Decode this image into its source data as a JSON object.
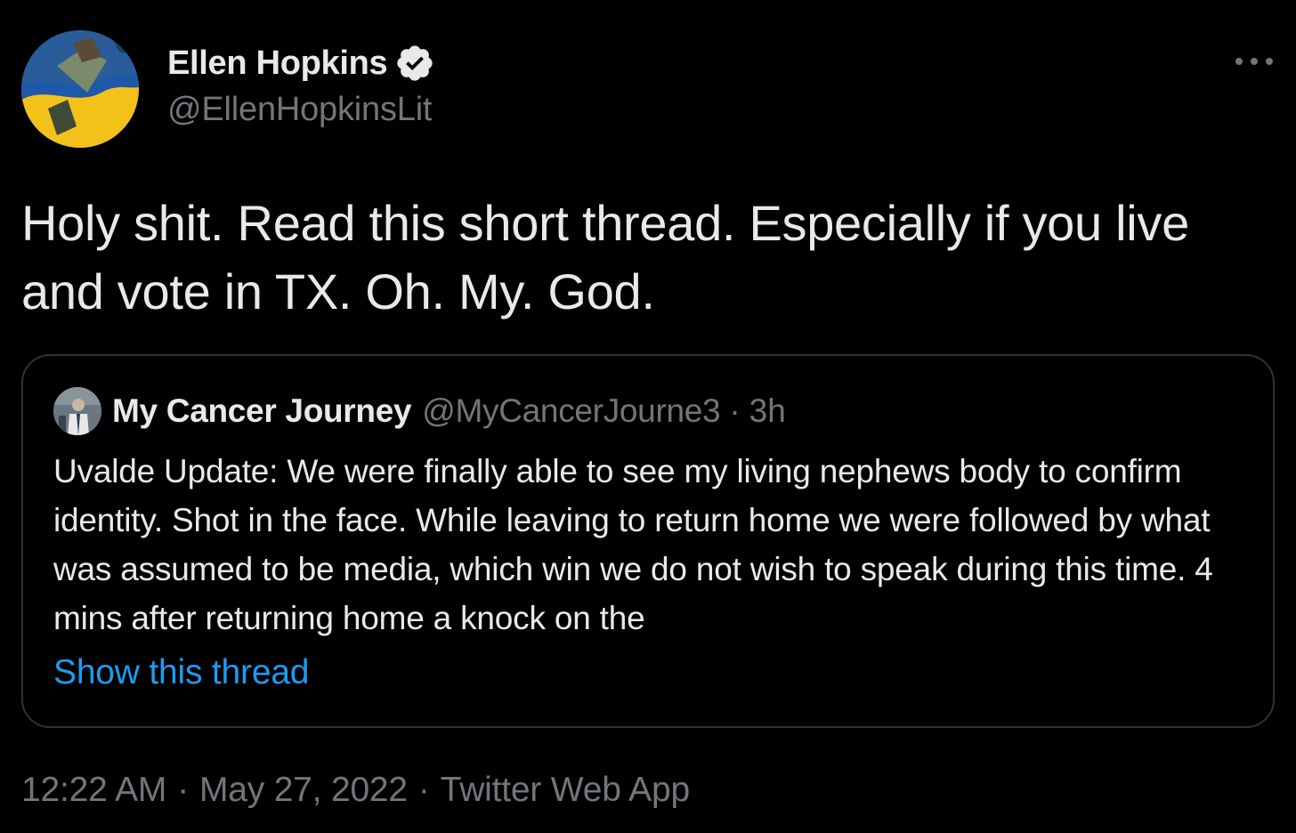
{
  "author": {
    "display_name": "Ellen Hopkins",
    "handle": "@EllenHopkinsLit",
    "verified": true
  },
  "tweet": {
    "text": "Holy shit. Read this short thread. Especially if you live and vote in TX. Oh. My. God."
  },
  "quoted_tweet": {
    "display_name": "My Cancer Journey",
    "handle": "@MyCancerJourne3",
    "separator": "·",
    "time": "3h",
    "text": "Uvalde Update: We were finally able to see my living nephews body to confirm identity. Shot in the face. While leaving to return home we were followed by what was assumed to be media, which win we do not wish to speak during this time. 4 mins after returning home a knock on the",
    "show_thread_label": "Show this thread"
  },
  "metadata": {
    "time": "12:22 AM",
    "separator": "·",
    "date": "May 27, 2022",
    "source": "Twitter Web App"
  },
  "colors": {
    "background": "#000000",
    "primary_text": "#e7e9ea",
    "secondary_text": "#71767b",
    "link": "#1d9bf0",
    "border": "#2f3336"
  },
  "icons": {
    "verified": "verified-badge-icon",
    "more": "more-options-icon"
  }
}
